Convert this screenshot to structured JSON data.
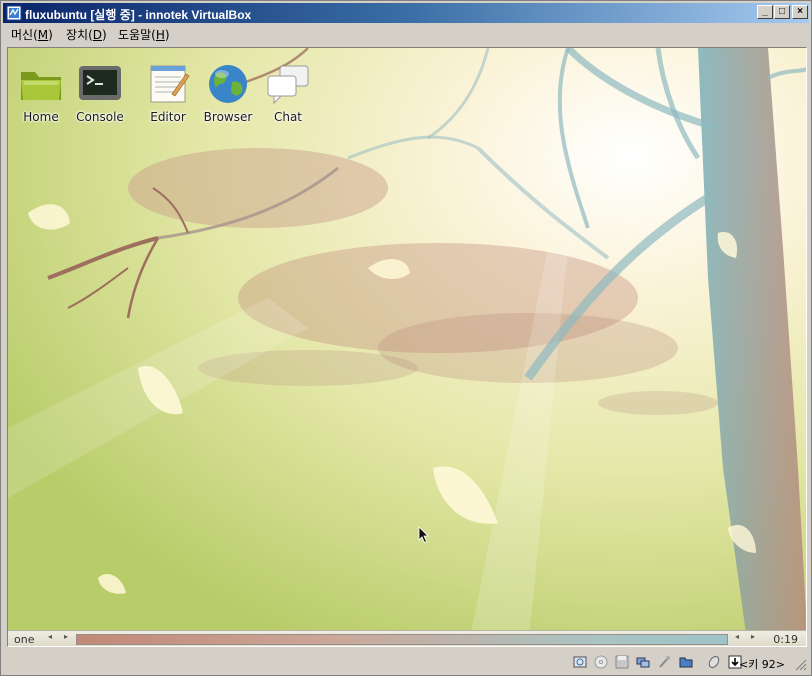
{
  "window": {
    "title": "fluxubuntu [실행 중] - innotek VirtualBox",
    "minimize_glyph": "_",
    "maximize_glyph": "□",
    "close_glyph": "×"
  },
  "menubar": {
    "items": [
      {
        "label": "머신(",
        "mnemonic": "M",
        "suffix": ")"
      },
      {
        "label": "장치(",
        "mnemonic": "D",
        "suffix": ")"
      },
      {
        "label": "도움말(",
        "mnemonic": "H",
        "suffix": ")"
      }
    ]
  },
  "desktop": {
    "icons": [
      {
        "label": "Home",
        "icon": "folder-icon"
      },
      {
        "label": "Console",
        "icon": "terminal-icon"
      },
      {
        "label": "Editor",
        "icon": "notepad-icon"
      },
      {
        "label": "Browser",
        "icon": "globe-icon"
      },
      {
        "label": "Chat",
        "icon": "chat-bubbles-icon"
      }
    ]
  },
  "slit": {
    "workspace": "one",
    "left_prev": "◂",
    "left_next": "▸",
    "right_prev": "◂",
    "right_next": "▸",
    "clock": "0:19"
  },
  "statusbar": {
    "host_key": "<키 92>",
    "indicators": [
      "hard-disk-icon",
      "cd-icon",
      "floppy-icon",
      "network-icon",
      "usb-icon",
      "shared-folder-icon",
      "mouse-integration-icon",
      "keyboard-capture-icon"
    ]
  },
  "colors": {
    "titlebar_start": "#0a246a",
    "titlebar_end": "#a6caf0",
    "chrome": "#d4d0c8"
  }
}
